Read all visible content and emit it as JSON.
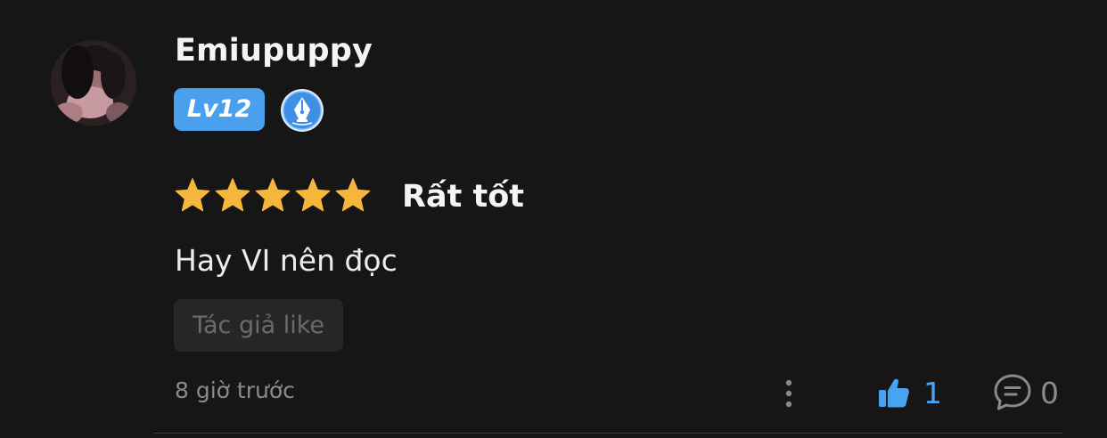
{
  "review": {
    "user": {
      "name": "Emiupuppy",
      "level": "Lv12",
      "avatar_icon": "user-avatar",
      "badge_icon": "fountain-pen-icon"
    },
    "rating": {
      "stars": 5,
      "max_stars": 5,
      "label": "Rất tốt",
      "star_color": "#f5b73b"
    },
    "text": "Hay VI nên đọc",
    "author_like_tag": "Tác giả like",
    "timestamp": "8 giờ trước",
    "actions": {
      "more_icon": "more-vertical-icon",
      "like_icon": "thumbs-up-icon",
      "like_count": "1",
      "comment_icon": "comment-icon",
      "comment_count": "0"
    }
  },
  "colors": {
    "background": "#161616",
    "accent_blue": "#4a9fef",
    "muted_text": "#8a8a8a"
  }
}
